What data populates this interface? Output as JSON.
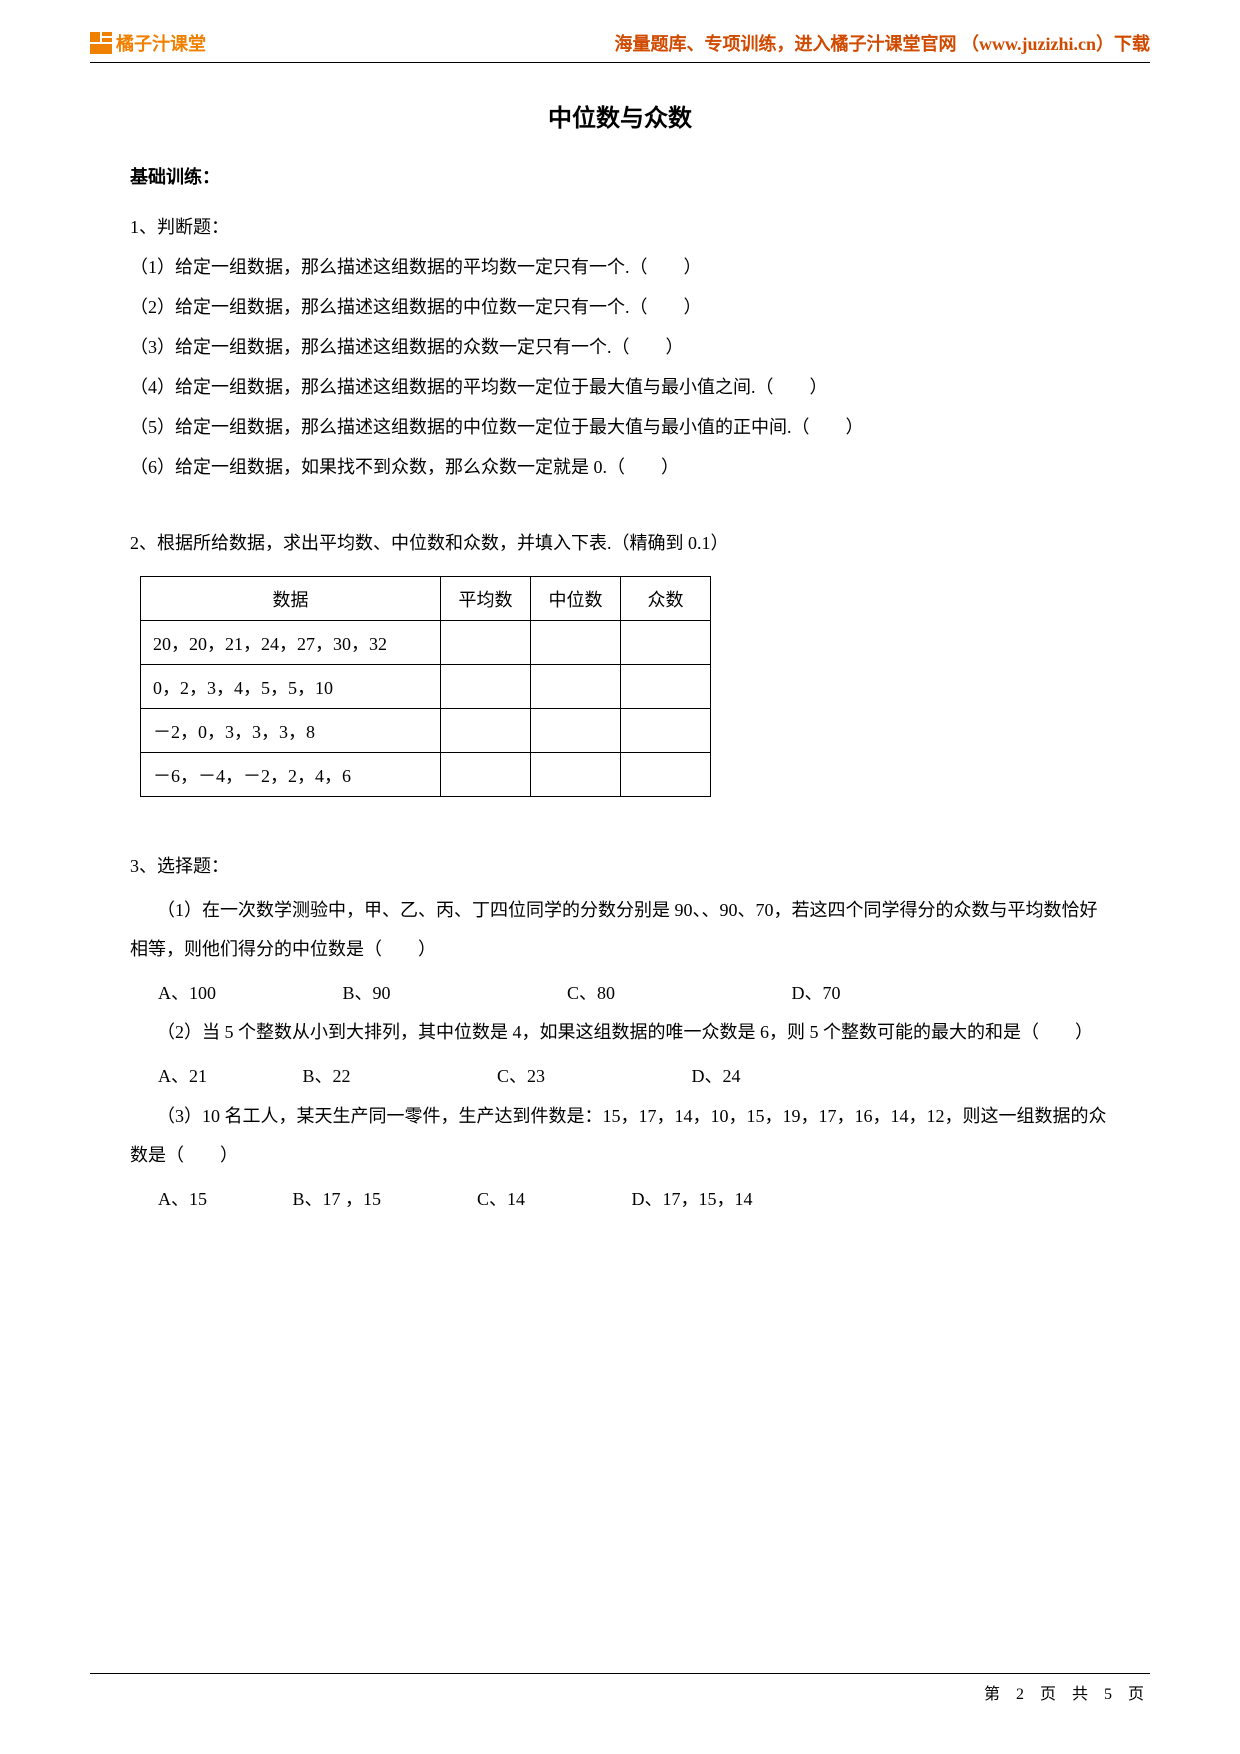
{
  "header": {
    "brand": "橘子汁课堂",
    "right": "海量题库、专项训练，进入橘子汁课堂官网 （www.juzizhi.cn）下载"
  },
  "title": "中位数与众数",
  "section_basic": "基础训练：",
  "q1": {
    "intro": "1、判断题：",
    "items": [
      "（1）给定一组数据，那么描述这组数据的平均数一定只有一个.（　　）",
      "（2）给定一组数据，那么描述这组数据的中位数一定只有一个.（　　）",
      "（3）给定一组数据，那么描述这组数据的众数一定只有一个.（　　）",
      "（4）给定一组数据，那么描述这组数据的平均数一定位于最大值与最小值之间.（　　）",
      "（5）给定一组数据，那么描述这组数据的中位数一定位于最大值与最小值的正中间.（　　）",
      "（6）给定一组数据，如果找不到众数，那么众数一定就是 0.（　　）"
    ]
  },
  "q2": {
    "intro": "2、根据所给数据，求出平均数、中位数和众数，并填入下表.（精确到 0.1）",
    "headers": [
      "数据",
      "平均数",
      "中位数",
      "众数"
    ],
    "rows": [
      [
        "20，20，21，24，27，30，32",
        "",
        "",
        ""
      ],
      [
        "0，2，3，4，5，5，10",
        "",
        "",
        ""
      ],
      [
        "－2，0，3，3，3，8",
        "",
        "",
        ""
      ],
      [
        "－6，－4，－2，2，4，6",
        "",
        "",
        ""
      ]
    ]
  },
  "q3": {
    "intro": "3、选择题：",
    "sub1": {
      "text": "　　（1）在一次数学测验中，甲、乙、丙、丁四位同学的分数分别是 90、、90、70，若这四个同学得分的众数与平均数恰好相等，则他们得分的中位数是（　　）",
      "opts": [
        "A、100",
        "B、90",
        "C、80",
        "D、70"
      ]
    },
    "sub2": {
      "text": "　　（2）当 5 个整数从小到大排列，其中位数是 4，如果这组数据的唯一众数是 6，则 5 个整数可能的最大的和是（　　）",
      "opts": [
        "A、21",
        "B、22",
        "C、23",
        "D、24"
      ]
    },
    "sub3": {
      "text": "　　（3）10 名工人，某天生产同一零件，生产达到件数是：15，17，14，10，15，19，17，16，14，12，则这一组数据的众数是（　　）",
      "opts": [
        "A、15",
        "B、17 ，15",
        "C、14",
        "D、17，15，14"
      ]
    }
  },
  "footer": "第 2 页 共 5 页"
}
